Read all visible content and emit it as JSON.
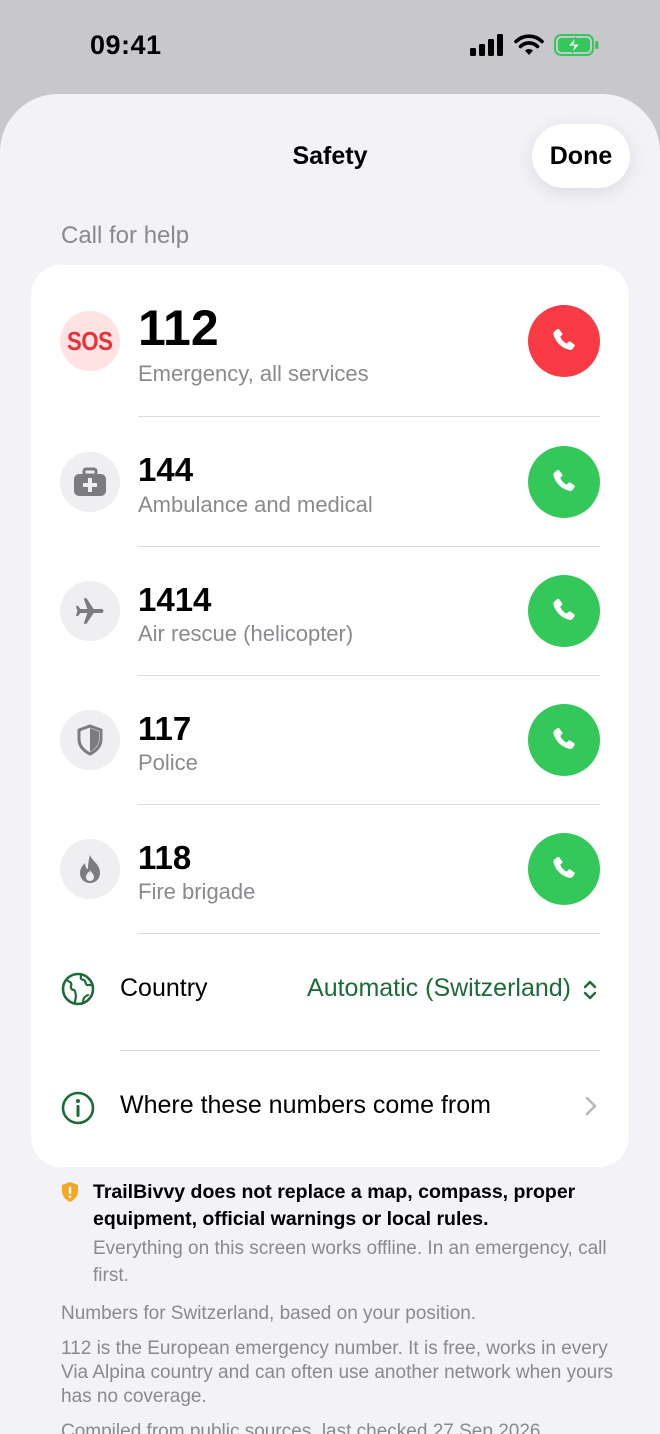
{
  "status_bar": {
    "time": "09:41"
  },
  "nav": {
    "title": "Safety",
    "done_label": "Done"
  },
  "section": {
    "header": "Call for help"
  },
  "emergency_numbers": [
    {
      "icon": "sos-icon",
      "icon_text": "SOS",
      "number": "112",
      "description": "Emergency, all services",
      "call_color": "#f73a44"
    },
    {
      "icon": "medical-kit-icon",
      "number": "144",
      "description": "Ambulance and medical",
      "call_color": "#34c759"
    },
    {
      "icon": "airplane-icon",
      "number": "1414",
      "description": "Air rescue (helicopter)",
      "call_color": "#34c759"
    },
    {
      "icon": "shield-icon",
      "number": "117",
      "description": "Police",
      "call_color": "#34c759"
    },
    {
      "icon": "flame-icon",
      "number": "118",
      "description": "Fire brigade",
      "call_color": "#34c759"
    }
  ],
  "country": {
    "label": "Country",
    "value": "Automatic (Switzerland)"
  },
  "info": {
    "label": "Where these numbers come from"
  },
  "disclaimer": {
    "strong": "TrailBivvy does not replace a map, compass, proper equipment, official warnings or local rules.",
    "sub": "Everything on this screen works offline. In an emergency, call first."
  },
  "footer": {
    "line1": "Numbers for Switzerland, based on your position.",
    "line2": "112 is the European emergency number. It is free, works in every Via Alpina country and can often use another network when yours has no coverage.",
    "line3": "Compiled from public sources, last checked 27 Sep 2026"
  },
  "colors": {
    "accent_green": "#1e6b3a",
    "call_green": "#34c759",
    "call_red": "#f73a44",
    "warning_orange": "#f5a623"
  }
}
